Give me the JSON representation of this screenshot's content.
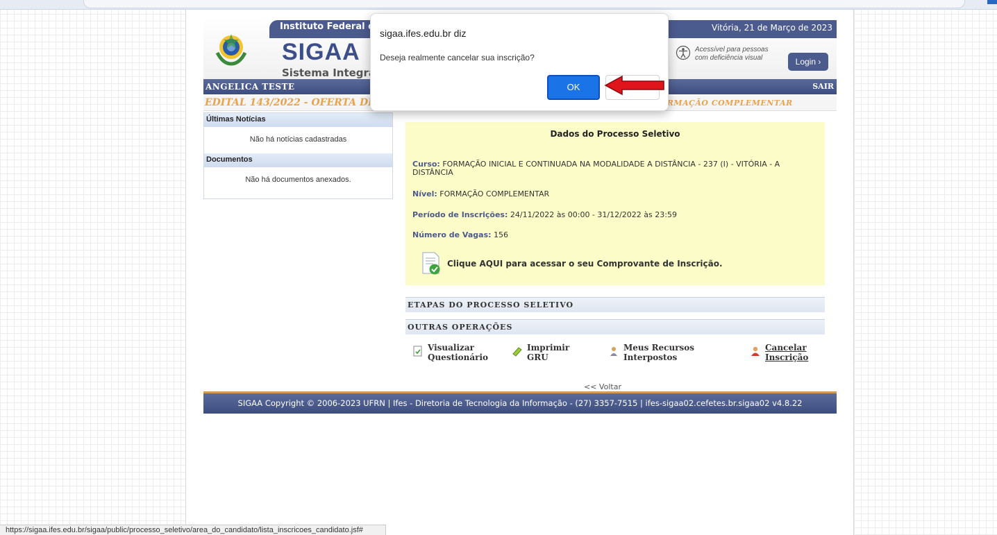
{
  "header": {
    "institution": "Instituto Federal do",
    "date": "Vitória, 21 de Março de 2023",
    "system_name": "SIGAA",
    "system_subtitle": "Sistema Integrado",
    "accessibility_line1": "Acessível para pessoas",
    "accessibility_line2": "com deficiência visual",
    "login_label": "Login ›"
  },
  "userbar": {
    "name": "ANGELICA TESTE",
    "logout": "SAIR"
  },
  "edital": {
    "left": "EDITAL 143/2022 - OFERTA DE V",
    "right": "- FORMAÇÃO COMPLEMENTAR"
  },
  "sidebar": {
    "news_title": "Últimas Notícias",
    "news_empty": "Não há notícias cadastradas",
    "docs_title": "Documentos",
    "docs_empty": "Não há documentos anexados."
  },
  "process": {
    "title": "Dados do Processo Seletivo",
    "curso_label": "Curso:",
    "curso_value": "FORMAÇÃO INICIAL E CONTINUADA NA MODALIDADE A DISTÂNCIA - 237 (I) - VITÓRIA - A DISTÂNCIA",
    "nivel_label": "Nível:",
    "nivel_value": "FORMAÇÃO COMPLEMENTAR",
    "periodo_label": "Período de Inscrições:",
    "periodo_value": "24/11/2022 às 00:00 - 31/12/2022 às 23:59",
    "vagas_label": "Número de Vagas:",
    "vagas_value": "156",
    "comprovante": "Clique AQUI para acessar o seu Comprovante de Inscrição."
  },
  "sections": {
    "etapas": "ETAPAS DO PROCESSO SELETIVO",
    "outras": "OUTRAS OPERAÇÕES"
  },
  "operations": {
    "questionario": "Visualizar\nQuestionário",
    "gru": "Imprimir\nGRU",
    "recursos": "Meus Recursos\nInterpostos",
    "cancelar": "Cancelar\nInscrição",
    "voltar": "<< Voltar"
  },
  "footer": "SIGAA Copyright © 2006-2023 UFRN | Ifes - Diretoria de Tecnologia da Informação - (27) 3357-7515 | ifes-sigaa02.cefetes.br.sigaa02 v4.8.22",
  "dialog": {
    "title": "sigaa.ifes.edu.br diz",
    "message": "Deseja realmente cancelar sua inscrição?",
    "ok": "OK"
  },
  "status_url": "https://sigaa.ifes.edu.br/sigaa/public/processo_seletivo/area_do_candidato/lista_inscricoes_candidato.jsf#",
  "colors": {
    "accent": "#1b73e8",
    "header": "#4b5b8e",
    "edital": "#e8a34d",
    "info_bg": "#fcfcc8",
    "arrow": "#e0141b"
  }
}
